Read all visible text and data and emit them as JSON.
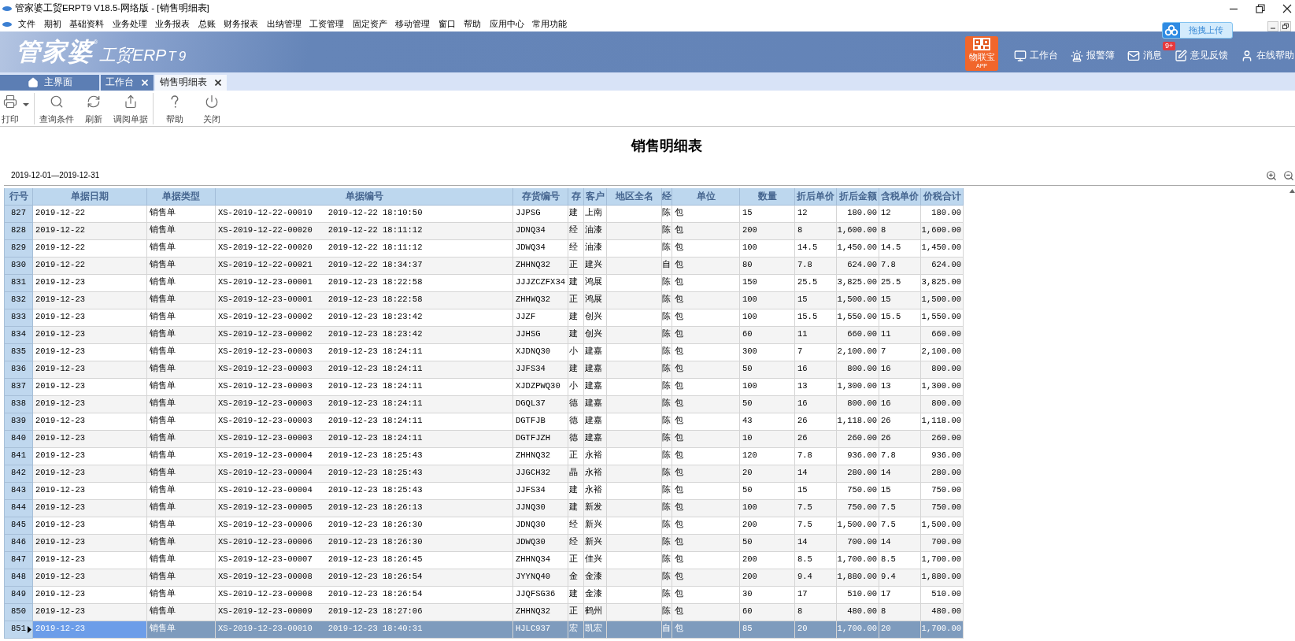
{
  "window": {
    "title": "管家婆工贸ERPT9 V18.5-网络版 - [销售明细表]"
  },
  "menu": [
    "文件",
    "期初",
    "基础资料",
    "业务处理",
    "业务报表",
    "总账",
    "财务报表",
    "出纳管理",
    "工资管理",
    "固定资产",
    "移动管理",
    "窗口",
    "帮助",
    "应用中心",
    "常用功能"
  ],
  "upload_button": {
    "label": "拖拽上传"
  },
  "banner": {
    "logo": {
      "wordmark": "管家婆",
      "mark": "®",
      "subtitle": "工贸ERP",
      "version": "T9"
    },
    "app_tile": {
      "title": "物联宝",
      "subtitle": "APP"
    },
    "links": [
      {
        "label": "工作台"
      },
      {
        "label": "报警簿"
      },
      {
        "label": "消息",
        "badge": "9+"
      },
      {
        "label": "意见反馈"
      },
      {
        "label": "在线帮助"
      }
    ]
  },
  "tabs": [
    {
      "label": "主界面",
      "kind": "home",
      "closable": false,
      "selected": false
    },
    {
      "label": "工作台",
      "kind": "page",
      "closable": true,
      "selected": false
    },
    {
      "label": "销售明细表",
      "kind": "page",
      "closable": true,
      "selected": true
    }
  ],
  "toolbar": {
    "groups": [
      [
        {
          "label": "打印",
          "has_menu": true
        }
      ],
      [
        {
          "label": "查询条件",
          "has_menu": false
        },
        {
          "label": "刷新",
          "has_menu": false
        },
        {
          "label": "调阅单据",
          "has_menu": false
        }
      ],
      [
        {
          "label": "帮助",
          "has_menu": false
        },
        {
          "label": "关闭",
          "has_menu": false
        }
      ]
    ]
  },
  "report": {
    "title": "销售明细表",
    "period": "2019-12-01—2019-12-31"
  },
  "table": {
    "columns": [
      "行号",
      "单据日期",
      "单据类型",
      "单据编号",
      "存货编号",
      "存",
      "客户",
      "地区全名",
      "经",
      "单位",
      "数量",
      "折后单价",
      "折后金额",
      "含税单价",
      "价税合计"
    ],
    "rows": [
      {
        "row_no": "827",
        "date": "2019-12-22",
        "doc_type": "销售单",
        "doc_no": "XS-2019-12-22-00019",
        "doc_time": "2019-12-22 18:10:50",
        "item_code": "JJPSG",
        "column_6": "建",
        "customer": "上南",
        "column_9": "陈",
        "unit": "包",
        "quantity": "15",
        "net_price": "12",
        "net_amount": "180.00",
        "tax_price": "12",
        "tax_total": "180.00",
        "selected": false
      },
      {
        "row_no": "828",
        "date": "2019-12-22",
        "doc_type": "销售单",
        "doc_no": "XS-2019-12-22-00020",
        "doc_time": "2019-12-22 18:11:12",
        "item_code": "JDNQ34",
        "column_6": "经",
        "customer": "油漆",
        "column_9": "陈",
        "unit": "包",
        "quantity": "200",
        "net_price": "8",
        "net_amount": "1,600.00",
        "tax_price": "8",
        "tax_total": "1,600.00",
        "selected": false
      },
      {
        "row_no": "829",
        "date": "2019-12-22",
        "doc_type": "销售单",
        "doc_no": "XS-2019-12-22-00020",
        "doc_time": "2019-12-22 18:11:12",
        "item_code": "JDWQ34",
        "column_6": "经",
        "customer": "油漆",
        "column_9": "陈",
        "unit": "包",
        "quantity": "100",
        "net_price": "14.5",
        "net_amount": "1,450.00",
        "tax_price": "14.5",
        "tax_total": "1,450.00",
        "selected": false
      },
      {
        "row_no": "830",
        "date": "2019-12-22",
        "doc_type": "销售单",
        "doc_no": "XS-2019-12-22-00021",
        "doc_time": "2019-12-22 18:34:37",
        "item_code": "ZHHNQ32",
        "column_6": "正",
        "customer": "建兴",
        "column_9": "自",
        "unit": "包",
        "quantity": "80",
        "net_price": "7.8",
        "net_amount": "624.00",
        "tax_price": "7.8",
        "tax_total": "624.00",
        "selected": false
      },
      {
        "row_no": "831",
        "date": "2019-12-23",
        "doc_type": "销售单",
        "doc_no": "XS-2019-12-23-00001",
        "doc_time": "2019-12-23 18:22:58",
        "item_code": "JJJZCZFX34",
        "column_6": "建",
        "customer": "鸿展",
        "column_9": "陈",
        "unit": "包",
        "quantity": "150",
        "net_price": "25.5",
        "net_amount": "3,825.00",
        "tax_price": "25.5",
        "tax_total": "3,825.00",
        "selected": false
      },
      {
        "row_no": "832",
        "date": "2019-12-23",
        "doc_type": "销售单",
        "doc_no": "XS-2019-12-23-00001",
        "doc_time": "2019-12-23 18:22:58",
        "item_code": "ZHHWQ32",
        "column_6": "正",
        "customer": "鸿展",
        "column_9": "陈",
        "unit": "包",
        "quantity": "100",
        "net_price": "15",
        "net_amount": "1,500.00",
        "tax_price": "15",
        "tax_total": "1,500.00",
        "selected": false
      },
      {
        "row_no": "833",
        "date": "2019-12-23",
        "doc_type": "销售单",
        "doc_no": "XS-2019-12-23-00002",
        "doc_time": "2019-12-23 18:23:42",
        "item_code": "JJZF",
        "column_6": "建",
        "customer": "创兴",
        "column_9": "陈",
        "unit": "包",
        "quantity": "100",
        "net_price": "15.5",
        "net_amount": "1,550.00",
        "tax_price": "15.5",
        "tax_total": "1,550.00",
        "selected": false
      },
      {
        "row_no": "834",
        "date": "2019-12-23",
        "doc_type": "销售单",
        "doc_no": "XS-2019-12-23-00002",
        "doc_time": "2019-12-23 18:23:42",
        "item_code": "JJHSG",
        "column_6": "建",
        "customer": "创兴",
        "column_9": "陈",
        "unit": "包",
        "quantity": "60",
        "net_price": "11",
        "net_amount": "660.00",
        "tax_price": "11",
        "tax_total": "660.00",
        "selected": false
      },
      {
        "row_no": "835",
        "date": "2019-12-23",
        "doc_type": "销售单",
        "doc_no": "XS-2019-12-23-00003",
        "doc_time": "2019-12-23 18:24:11",
        "item_code": "XJDNQ30",
        "column_6": "小",
        "customer": "建嘉",
        "column_9": "陈",
        "unit": "包",
        "quantity": "300",
        "net_price": "7",
        "net_amount": "2,100.00",
        "tax_price": "7",
        "tax_total": "2,100.00",
        "selected": false
      },
      {
        "row_no": "836",
        "date": "2019-12-23",
        "doc_type": "销售单",
        "doc_no": "XS-2019-12-23-00003",
        "doc_time": "2019-12-23 18:24:11",
        "item_code": "JJFS34",
        "column_6": "建",
        "customer": "建嘉",
        "column_9": "陈",
        "unit": "包",
        "quantity": "50",
        "net_price": "16",
        "net_amount": "800.00",
        "tax_price": "16",
        "tax_total": "800.00",
        "selected": false
      },
      {
        "row_no": "837",
        "date": "2019-12-23",
        "doc_type": "销售单",
        "doc_no": "XS-2019-12-23-00003",
        "doc_time": "2019-12-23 18:24:11",
        "item_code": "XJDZPWQ30",
        "column_6": "小",
        "customer": "建嘉",
        "column_9": "陈",
        "unit": "包",
        "quantity": "100",
        "net_price": "13",
        "net_amount": "1,300.00",
        "tax_price": "13",
        "tax_total": "1,300.00",
        "selected": false
      },
      {
        "row_no": "838",
        "date": "2019-12-23",
        "doc_type": "销售单",
        "doc_no": "XS-2019-12-23-00003",
        "doc_time": "2019-12-23 18:24:11",
        "item_code": "DGQL37",
        "column_6": "德",
        "customer": "建嘉",
        "column_9": "陈",
        "unit": "包",
        "quantity": "50",
        "net_price": "16",
        "net_amount": "800.00",
        "tax_price": "16",
        "tax_total": "800.00",
        "selected": false
      },
      {
        "row_no": "839",
        "date": "2019-12-23",
        "doc_type": "销售单",
        "doc_no": "XS-2019-12-23-00003",
        "doc_time": "2019-12-23 18:24:11",
        "item_code": "DGTFJB",
        "column_6": "德",
        "customer": "建嘉",
        "column_9": "陈",
        "unit": "包",
        "quantity": "43",
        "net_price": "26",
        "net_amount": "1,118.00",
        "tax_price": "26",
        "tax_total": "1,118.00",
        "selected": false
      },
      {
        "row_no": "840",
        "date": "2019-12-23",
        "doc_type": "销售单",
        "doc_no": "XS-2019-12-23-00003",
        "doc_time": "2019-12-23 18:24:11",
        "item_code": "DGTFJZH",
        "column_6": "德",
        "customer": "建嘉",
        "column_9": "陈",
        "unit": "包",
        "quantity": "10",
        "net_price": "26",
        "net_amount": "260.00",
        "tax_price": "26",
        "tax_total": "260.00",
        "selected": false
      },
      {
        "row_no": "841",
        "date": "2019-12-23",
        "doc_type": "销售单",
        "doc_no": "XS-2019-12-23-00004",
        "doc_time": "2019-12-23 18:25:43",
        "item_code": "ZHHNQ32",
        "column_6": "正",
        "customer": "永裕",
        "column_9": "陈",
        "unit": "包",
        "quantity": "120",
        "net_price": "7.8",
        "net_amount": "936.00",
        "tax_price": "7.8",
        "tax_total": "936.00",
        "selected": false
      },
      {
        "row_no": "842",
        "date": "2019-12-23",
        "doc_type": "销售单",
        "doc_no": "XS-2019-12-23-00004",
        "doc_time": "2019-12-23 18:25:43",
        "item_code": "JJGCH32",
        "column_6": "晶",
        "customer": "永裕",
        "column_9": "陈",
        "unit": "包",
        "quantity": "20",
        "net_price": "14",
        "net_amount": "280.00",
        "tax_price": "14",
        "tax_total": "280.00",
        "selected": false
      },
      {
        "row_no": "843",
        "date": "2019-12-23",
        "doc_type": "销售单",
        "doc_no": "XS-2019-12-23-00004",
        "doc_time": "2019-12-23 18:25:43",
        "item_code": "JJFS34",
        "column_6": "建",
        "customer": "永裕",
        "column_9": "陈",
        "unit": "包",
        "quantity": "50",
        "net_price": "15",
        "net_amount": "750.00",
        "tax_price": "15",
        "tax_total": "750.00",
        "selected": false
      },
      {
        "row_no": "844",
        "date": "2019-12-23",
        "doc_type": "销售单",
        "doc_no": "XS-2019-12-23-00005",
        "doc_time": "2019-12-23 18:26:13",
        "item_code": "JJNQ30",
        "column_6": "建",
        "customer": "新发",
        "column_9": "陈",
        "unit": "包",
        "quantity": "100",
        "net_price": "7.5",
        "net_amount": "750.00",
        "tax_price": "7.5",
        "tax_total": "750.00",
        "selected": false
      },
      {
        "row_no": "845",
        "date": "2019-12-23",
        "doc_type": "销售单",
        "doc_no": "XS-2019-12-23-00006",
        "doc_time": "2019-12-23 18:26:30",
        "item_code": "JDNQ30",
        "column_6": "经",
        "customer": "新兴",
        "column_9": "陈",
        "unit": "包",
        "quantity": "200",
        "net_price": "7.5",
        "net_amount": "1,500.00",
        "tax_price": "7.5",
        "tax_total": "1,500.00",
        "selected": false
      },
      {
        "row_no": "846",
        "date": "2019-12-23",
        "doc_type": "销售单",
        "doc_no": "XS-2019-12-23-00006",
        "doc_time": "2019-12-23 18:26:30",
        "item_code": "JDWQ30",
        "column_6": "经",
        "customer": "新兴",
        "column_9": "陈",
        "unit": "包",
        "quantity": "50",
        "net_price": "14",
        "net_amount": "700.00",
        "tax_price": "14",
        "tax_total": "700.00",
        "selected": false
      },
      {
        "row_no": "847",
        "date": "2019-12-23",
        "doc_type": "销售单",
        "doc_no": "XS-2019-12-23-00007",
        "doc_time": "2019-12-23 18:26:45",
        "item_code": "ZHHNQ34",
        "column_6": "正",
        "customer": "佳兴",
        "column_9": "陈",
        "unit": "包",
        "quantity": "200",
        "net_price": "8.5",
        "net_amount": "1,700.00",
        "tax_price": "8.5",
        "tax_total": "1,700.00",
        "selected": false
      },
      {
        "row_no": "848",
        "date": "2019-12-23",
        "doc_type": "销售单",
        "doc_no": "XS-2019-12-23-00008",
        "doc_time": "2019-12-23 18:26:54",
        "item_code": "JYYNQ40",
        "column_6": "金",
        "customer": "金漆",
        "column_9": "陈",
        "unit": "包",
        "quantity": "200",
        "net_price": "9.4",
        "net_amount": "1,880.00",
        "tax_price": "9.4",
        "tax_total": "1,880.00",
        "selected": false
      },
      {
        "row_no": "849",
        "date": "2019-12-23",
        "doc_type": "销售单",
        "doc_no": "XS-2019-12-23-00008",
        "doc_time": "2019-12-23 18:26:54",
        "item_code": "JJQFSG36",
        "column_6": "建",
        "customer": "金漆",
        "column_9": "陈",
        "unit": "包",
        "quantity": "30",
        "net_price": "17",
        "net_amount": "510.00",
        "tax_price": "17",
        "tax_total": "510.00",
        "selected": false
      },
      {
        "row_no": "850",
        "date": "2019-12-23",
        "doc_type": "销售单",
        "doc_no": "XS-2019-12-23-00009",
        "doc_time": "2019-12-23 18:27:06",
        "item_code": "ZHHNQ32",
        "column_6": "正",
        "customer": "鹤州",
        "column_9": "陈",
        "unit": "包",
        "quantity": "60",
        "net_price": "8",
        "net_amount": "480.00",
        "tax_price": "8",
        "tax_total": "480.00",
        "selected": false
      },
      {
        "row_no": "851",
        "date": "2019-12-23",
        "doc_type": "销售单",
        "doc_no": "XS-2019-12-23-00010",
        "doc_time": "2019-12-23 18:40:31",
        "item_code": "HJLC937",
        "column_6": "宏",
        "customer": "凯宏",
        "column_9": "自",
        "unit": "包",
        "quantity": "85",
        "net_price": "20",
        "net_amount": "1,700.00",
        "tax_price": "20",
        "tax_total": "1,700.00",
        "selected": true
      }
    ]
  }
}
